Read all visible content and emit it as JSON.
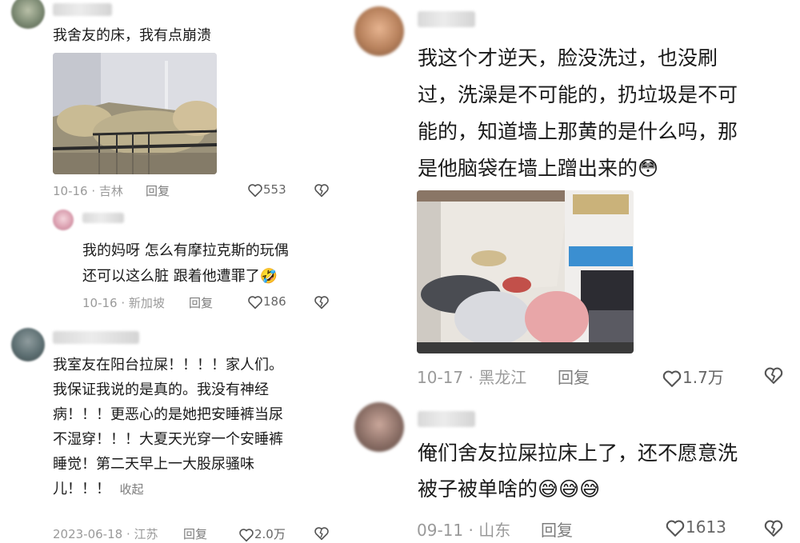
{
  "left": {
    "comments": [
      {
        "text_lines": [
          "我舍友的床，我有点崩溃"
        ],
        "date": "10-16",
        "location": "吉林",
        "reply_label": "回复",
        "likes": "553",
        "image_desc": "dorm-bed-photo"
      },
      {
        "text_lines": [
          "我的妈呀 怎么有摩拉克斯的玩偶",
          "还可以这么脏 跟着他遭罪了🤣"
        ],
        "date": "10-16",
        "location": "新加坡",
        "reply_label": "回复",
        "likes": "186"
      },
      {
        "text_lines": [
          "我室友在阳台拉屎！！！！家人们。",
          "我保证我说的是真的。我没有神经",
          "病！！！更恶心的是她把安睡裤当尿",
          "不湿穿！！！大夏天光穿一个安睡裤",
          "睡觉！第二天早上一大股尿骚味",
          "儿！！！"
        ],
        "collapse_label": "收起",
        "date": "2023-06-18",
        "location": "江苏",
        "reply_label": "回复",
        "likes": "2.0万"
      }
    ]
  },
  "right": {
    "comments": [
      {
        "text_lines": [
          "我这个才逆天，脸没洗过，也没刷",
          "过，洗澡是不可能的，扔垃圾是不可",
          "能的，知道墙上那黄的是什么吗，那",
          "是他脑袋在墙上蹭出来的😳"
        ],
        "date": "10-17",
        "location": "黑龙江",
        "reply_label": "回复",
        "likes": "1.7万",
        "image_desc": "messy-dorm-photo"
      },
      {
        "text_lines": [
          "俺们舍友拉屎拉床上了，还不愿意洗",
          "被子被单啥的😅😅😅"
        ],
        "date": "09-11",
        "location": "山东",
        "reply_label": "回复",
        "likes": "1613"
      }
    ]
  },
  "colors": {
    "meta": "#9a9a9a",
    "text": "#1a1a1a",
    "background": "#ffffff"
  },
  "icons": {
    "like": "heart-outline-icon",
    "dislike": "broken-heart-icon"
  }
}
